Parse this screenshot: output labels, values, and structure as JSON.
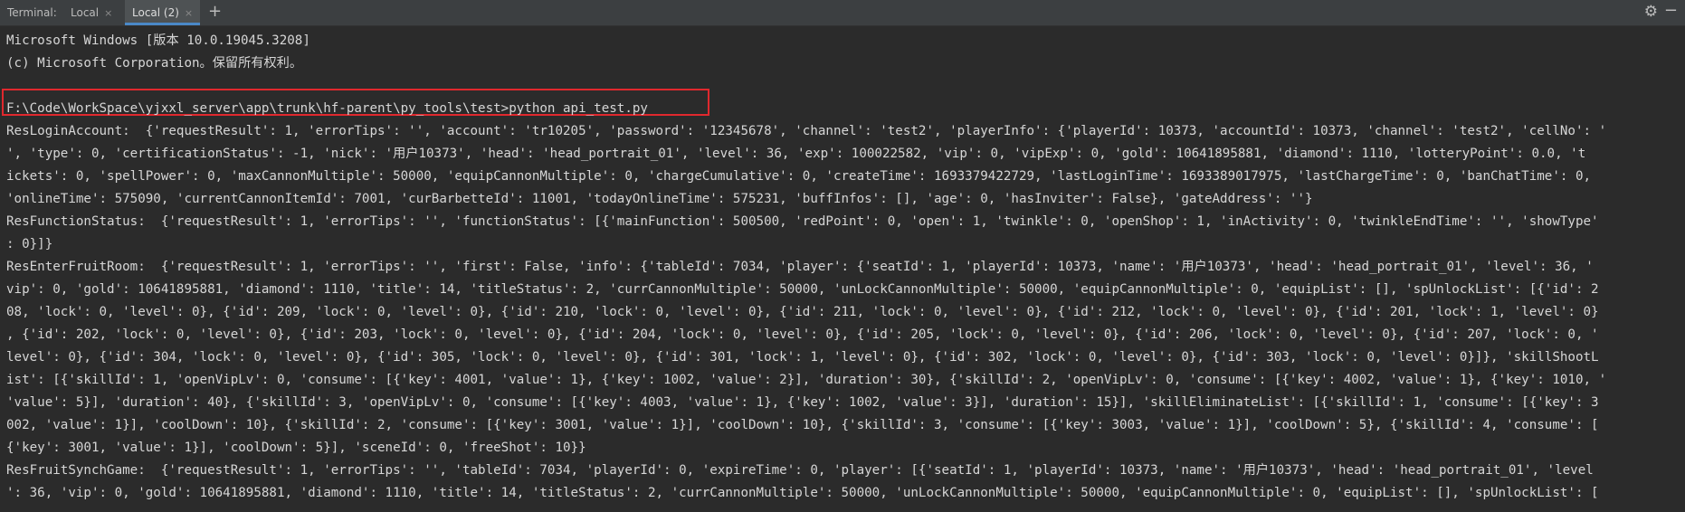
{
  "tabbar": {
    "label": "Terminal:",
    "tabs": [
      {
        "label": "Local",
        "close": "×"
      },
      {
        "label": "Local (2)",
        "close": "×"
      }
    ],
    "add": "+",
    "settings_icon": "gear-icon",
    "minimize_icon": "minus-icon"
  },
  "terminal": {
    "lines": [
      "Microsoft Windows [版本 10.0.19045.3208]",
      "(c) Microsoft Corporation。保留所有权利。",
      "",
      "F:\\Code\\WorkSpace\\yjxxl_server\\app\\trunk\\hf-parent\\py_tools\\test>python api_test.py",
      "ResLoginAccount:  {'requestResult': 1, 'errorTips': '', 'account': 'tr10205', 'password': '12345678', 'channel': 'test2', 'playerInfo': {'playerId': 10373, 'accountId': 10373, 'channel': 'test2', 'cellNo': '",
      "', 'type': 0, 'certificationStatus': -1, 'nick': '用户10373', 'head': 'head_portrait_01', 'level': 36, 'exp': 100022582, 'vip': 0, 'vipExp': 0, 'gold': 10641895881, 'diamond': 1110, 'lotteryPoint': 0.0, 't",
      "ickets': 0, 'spellPower': 0, 'maxCannonMultiple': 50000, 'equipCannonMultiple': 0, 'chargeCumulative': 0, 'createTime': 1693379422729, 'lastLoginTime': 1693389017975, 'lastChargeTime': 0, 'banChatTime': 0,",
      "'onlineTime': 575090, 'currentCannonItemId': 7001, 'curBarbetteId': 11001, 'todayOnlineTime': 575231, 'buffInfos': [], 'age': 0, 'hasInviter': False}, 'gateAddress': ''}",
      "ResFunctionStatus:  {'requestResult': 1, 'errorTips': '', 'functionStatus': [{'mainFunction': 500500, 'redPoint': 0, 'open': 1, 'twinkle': 0, 'openShop': 1, 'inActivity': 0, 'twinkleEndTime': '', 'showType'",
      ": 0}]}",
      "ResEnterFruitRoom:  {'requestResult': 1, 'errorTips': '', 'first': False, 'info': {'tableId': 7034, 'player': {'seatId': 1, 'playerId': 10373, 'name': '用户10373', 'head': 'head_portrait_01', 'level': 36, '",
      "vip': 0, 'gold': 10641895881, 'diamond': 1110, 'title': 14, 'titleStatus': 2, 'currCannonMultiple': 50000, 'unLockCannonMultiple': 50000, 'equipCannonMultiple': 0, 'equipList': [], 'spUnlockList': [{'id': 2",
      "08, 'lock': 0, 'level': 0}, {'id': 209, 'lock': 0, 'level': 0}, {'id': 210, 'lock': 0, 'level': 0}, {'id': 211, 'lock': 0, 'level': 0}, {'id': 212, 'lock': 0, 'level': 0}, {'id': 201, 'lock': 1, 'level': 0}",
      ", {'id': 202, 'lock': 0, 'level': 0}, {'id': 203, 'lock': 0, 'level': 0}, {'id': 204, 'lock': 0, 'level': 0}, {'id': 205, 'lock': 0, 'level': 0}, {'id': 206, 'lock': 0, 'level': 0}, {'id': 207, 'lock': 0, '",
      "level': 0}, {'id': 304, 'lock': 0, 'level': 0}, {'id': 305, 'lock': 0, 'level': 0}, {'id': 301, 'lock': 1, 'level': 0}, {'id': 302, 'lock': 0, 'level': 0}, {'id': 303, 'lock': 0, 'level': 0}]}, 'skillShootL",
      "ist': [{'skillId': 1, 'openVipLv': 0, 'consume': [{'key': 4001, 'value': 1}, {'key': 1002, 'value': 2}], 'duration': 30}, {'skillId': 2, 'openVipLv': 0, 'consume': [{'key': 4002, 'value': 1}, {'key': 1010, '",
      "'value': 5}], 'duration': 40}, {'skillId': 3, 'openVipLv': 0, 'consume': [{'key': 4003, 'value': 1}, {'key': 1002, 'value': 3}], 'duration': 15}], 'skillEliminateList': [{'skillId': 1, 'consume': [{'key': 3",
      "002, 'value': 1}], 'coolDown': 10}, {'skillId': 2, 'consume': [{'key': 3001, 'value': 1}], 'coolDown': 10}, {'skillId': 3, 'consume': [{'key': 3003, 'value': 1}], 'coolDown': 5}, {'skillId': 4, 'consume': [",
      "{'key': 3001, 'value': 1}], 'coolDown': 5}], 'sceneId': 0, 'freeShot': 10}}",
      "ResFruitSynchGame:  {'requestResult': 1, 'errorTips': '', 'tableId': 7034, 'playerId': 0, 'expireTime': 0, 'player': [{'seatId': 1, 'playerId': 10373, 'name': '用户10373', 'head': 'head_portrait_01', 'level",
      "': 36, 'vip': 0, 'gold': 10641895881, 'diamond': 1110, 'title': 14, 'titleStatus': 2, 'currCannonMultiple': 50000, 'unLockCannonMultiple': 50000, 'equipCannonMultiple': 0, 'equipList': [], 'spUnlockList': ["
    ]
  }
}
